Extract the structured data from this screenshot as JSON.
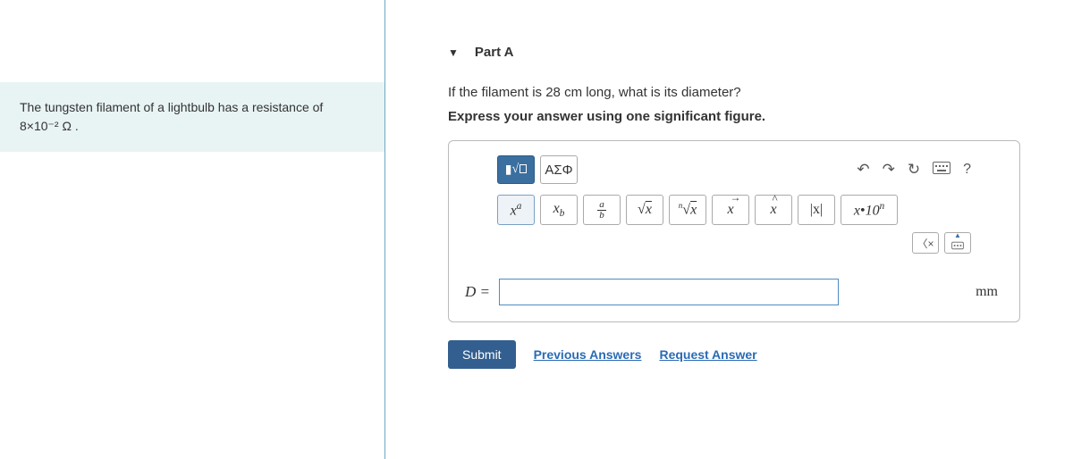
{
  "problem": {
    "text_html": "The tungsten filament of a lightbulb has a resistance of 8×10⁻² Ω ."
  },
  "part": {
    "label": "Part A",
    "question_html": "If the filament is 28 cm long, what is its diameter?",
    "instruction": "Express your answer using one significant figure."
  },
  "toolbar1": {
    "math_templates": "▮√▢",
    "greek": "ΑΣΦ",
    "help": "?"
  },
  "toolbar2": {
    "superscript": "xᵃ",
    "subscript": "x_b",
    "fraction_num": "a",
    "fraction_den": "b",
    "sqrt": "√x",
    "nroot": "ⁿ√x",
    "vector": "x⃗",
    "hat": "x̂",
    "abs": "|x|",
    "sci": "x•10ⁿ"
  },
  "mini": {
    "backspace": "⌫"
  },
  "answer": {
    "label": "D =",
    "value": "",
    "unit": "mm"
  },
  "actions": {
    "submit": "Submit",
    "previous": "Previous Answers",
    "request": "Request Answer"
  }
}
